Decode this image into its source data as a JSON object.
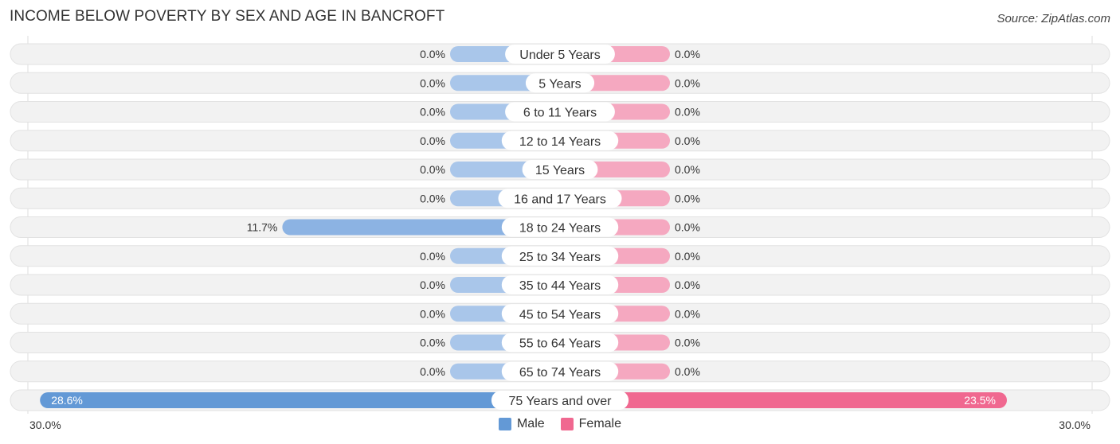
{
  "title": "INCOME BELOW POVERTY BY SEX AND AGE IN BANCROFT",
  "source": "Source: ZipAtlas.com",
  "legend": {
    "male": "Male",
    "female": "Female"
  },
  "axis": {
    "left_label": "30.0%",
    "right_label": "30.0%"
  },
  "colors": {
    "male_stub": "#a9c6ea",
    "male_bar": "#8cb3e3",
    "male_full": "#6399d6",
    "female_stub": "#f5a8c0",
    "female_full": "#f06890",
    "row_bg": "#f2f2f2",
    "legend_male": "#6399d6",
    "legend_female": "#f06890"
  },
  "chart_data": {
    "type": "bar",
    "orientation": "horizontal-diverging",
    "title": "INCOME BELOW POVERTY BY SEX AND AGE IN BANCROFT",
    "xlim": [
      -30,
      30
    ],
    "x_tick_labels": [
      "30.0%",
      "30.0%"
    ],
    "categories": [
      "Under 5 Years",
      "5 Years",
      "6 to 11 Years",
      "12 to 14 Years",
      "15 Years",
      "16 and 17 Years",
      "18 to 24 Years",
      "25 to 34 Years",
      "35 to 44 Years",
      "45 to 54 Years",
      "55 to 64 Years",
      "65 to 74 Years",
      "75 Years and over"
    ],
    "series": [
      {
        "name": "Male",
        "values": [
          0.0,
          0.0,
          0.0,
          0.0,
          0.0,
          0.0,
          11.7,
          0.0,
          0.0,
          0.0,
          0.0,
          0.0,
          28.6
        ],
        "labels": [
          "0.0%",
          "0.0%",
          "0.0%",
          "0.0%",
          "0.0%",
          "0.0%",
          "11.7%",
          "0.0%",
          "0.0%",
          "0.0%",
          "0.0%",
          "0.0%",
          "28.6%"
        ]
      },
      {
        "name": "Female",
        "values": [
          0.0,
          0.0,
          0.0,
          0.0,
          0.0,
          0.0,
          0.0,
          0.0,
          0.0,
          0.0,
          0.0,
          0.0,
          23.5
        ],
        "labels": [
          "0.0%",
          "0.0%",
          "0.0%",
          "0.0%",
          "0.0%",
          "0.0%",
          "0.0%",
          "0.0%",
          "0.0%",
          "0.0%",
          "0.0%",
          "0.0%",
          "23.5%"
        ]
      }
    ],
    "legend_position": "bottom-center"
  }
}
